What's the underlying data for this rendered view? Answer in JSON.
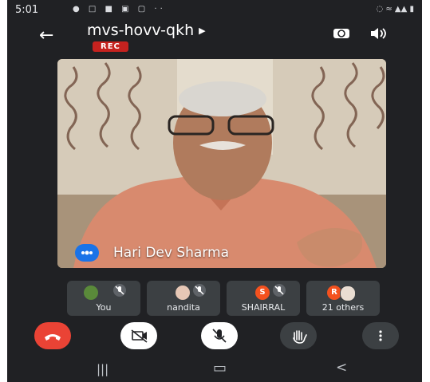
{
  "status_bar": {
    "time": "5:01"
  },
  "header": {
    "meeting_code": "mvs-hovv-qkh",
    "recording_badge": "REC"
  },
  "main_speaker": {
    "name": "Hari Dev Sharma"
  },
  "participants": [
    {
      "label": "You"
    },
    {
      "label": "nandita"
    },
    {
      "label": "SHAIRRAL",
      "avatar_letter": "S"
    },
    {
      "label": "21 others",
      "avatar_letter": "R"
    }
  ],
  "colors": {
    "end_call": "#ea4335",
    "recording": "#c5221f",
    "speaking": "#1a73e8",
    "avatar_orange": "#f4511e"
  },
  "icons": [
    "back-arrow-icon",
    "chevron-right-icon",
    "switch-camera-icon",
    "speaker-icon",
    "end-call-icon",
    "camera-off-icon",
    "mic-off-icon",
    "raise-hand-icon",
    "more-options-icon"
  ]
}
